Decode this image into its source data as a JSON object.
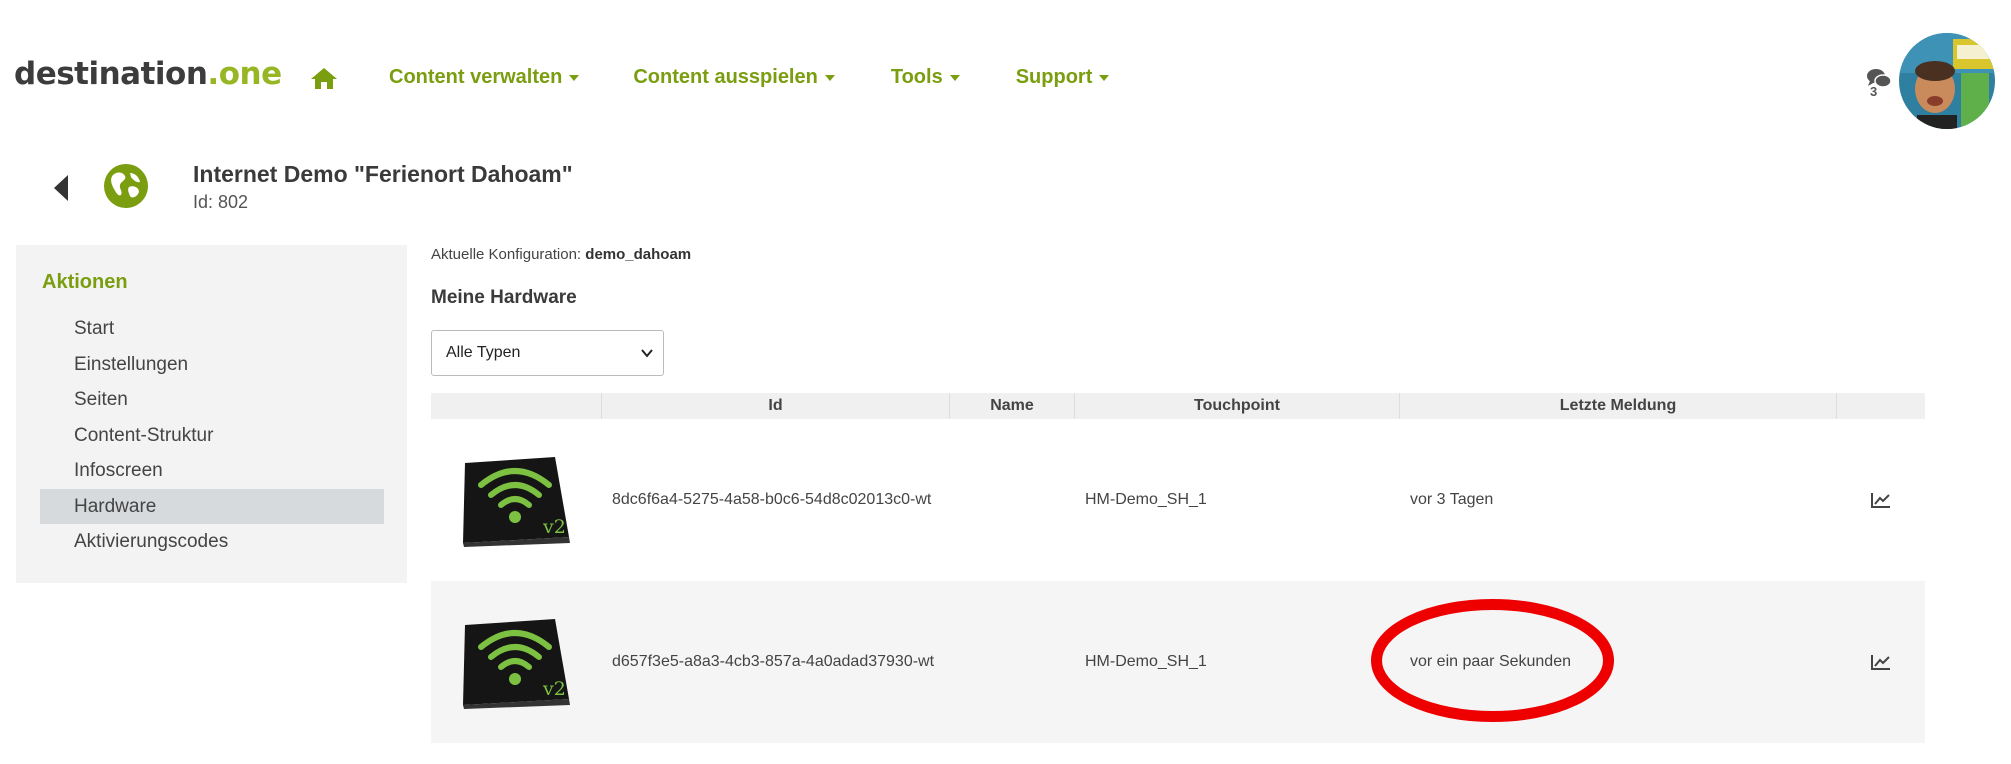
{
  "brand": {
    "name": "destination",
    "suffix": ".one",
    "accent": "#96b624"
  },
  "nav": [
    {
      "label": "Content verwalten"
    },
    {
      "label": "Content ausspielen"
    },
    {
      "label": "Tools"
    },
    {
      "label": "Support"
    }
  ],
  "header": {
    "notification_count": "3"
  },
  "page": {
    "title": "Internet Demo \"Ferienort Dahoam\"",
    "id_label": "Id: 802"
  },
  "sidebar": {
    "heading": "Aktionen",
    "items": [
      {
        "label": "Start"
      },
      {
        "label": "Einstellungen"
      },
      {
        "label": "Seiten"
      },
      {
        "label": "Content-Struktur"
      },
      {
        "label": "Infoscreen"
      },
      {
        "label": "Hardware",
        "active": true
      },
      {
        "label": "Aktivierungscodes"
      }
    ]
  },
  "config": {
    "prefix": "Aktuelle Konfiguration:",
    "value": "demo_dahoam"
  },
  "hardware": {
    "title": "Meine Hardware",
    "filter": {
      "selected": "Alle Typen"
    },
    "columns": [
      "Id",
      "Name",
      "Touchpoint",
      "Letzte Meldung"
    ],
    "rows": [
      {
        "id": "8dc6f6a4-5275-4a58-b0c6-54d8c02013c0-wt",
        "name": "",
        "touchpoint": "HM-Demo_SH_1",
        "last_message": "vor 3 Tagen",
        "badge": "v2"
      },
      {
        "id": "d657f3e5-a8a3-4cb3-857a-4a0adad37930-wt",
        "name": "",
        "touchpoint": "HM-Demo_SH_1",
        "last_message": "vor ein paar Sekunden",
        "badge": "v2",
        "highlighted": true
      }
    ]
  },
  "icons": {
    "home": "home-icon",
    "chat": "chat-icon",
    "back": "arrow-left-icon",
    "globe": "globe-icon",
    "chart": "line-chart-icon",
    "device": "wifi-device-icon"
  },
  "colors": {
    "nav_green": "#7a9e10",
    "highlight_ring": "#ee0000",
    "active_item": "#d6dadd"
  }
}
